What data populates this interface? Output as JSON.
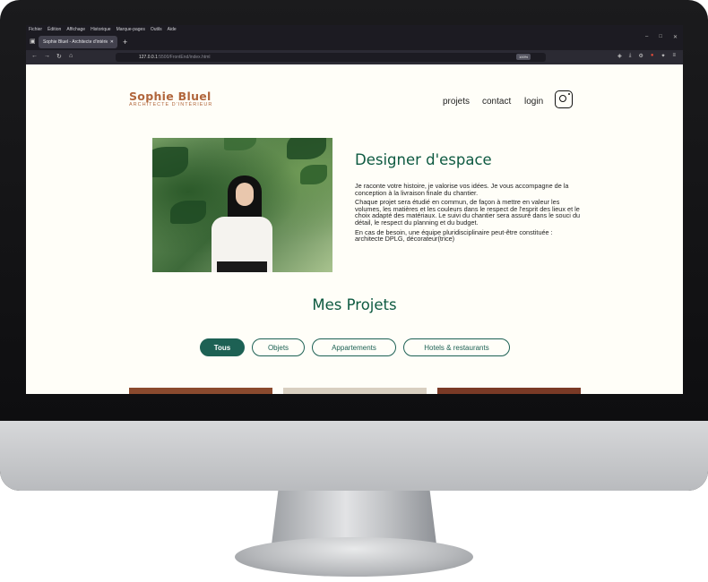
{
  "browser": {
    "menu": [
      "Fichier",
      "Édition",
      "Affichage",
      "Historique",
      "Marque-pages",
      "Outils",
      "Aide"
    ],
    "tab_title": "Sophie Bluel - Architecte d'intérieur",
    "url_main": "127.0.0.1",
    "url_rest": ":5500/FrontEnd/index.html",
    "zoom": "100%"
  },
  "header": {
    "logo": "Sophie Bluel",
    "logo_sub": "ARCHITECTE D'INTÉRIEUR",
    "nav": [
      "projets",
      "contact",
      "login"
    ]
  },
  "intro": {
    "title": "Designer d'espace",
    "paragraphs": [
      "Je raconte votre histoire, je valorise vos idées. Je vous accompagne de la conception à la livraison finale du chantier.",
      "Chaque projet sera étudié en commun, de façon à mettre en valeur les volumes, les matières et les couleurs dans le respect de l'esprit des lieux et le choix adapté des matériaux. Le suivi du chantier sera assuré dans le souci du détail, le respect du planning et du budget.",
      "En cas de besoin, une équipe pluridisciplinaire peut-être constituée : architecte DPLG, décorateur(trice)"
    ]
  },
  "projects": {
    "title": "Mes Projets",
    "filters": [
      "Tous",
      "Objets",
      "Appartements",
      "Hotels & restaurants"
    ],
    "active_filter": "Tous"
  },
  "colors": {
    "brand": "#b1663c",
    "accent_green": "#1d6154",
    "title_green": "#0e5a41",
    "background": "#fffef8"
  }
}
